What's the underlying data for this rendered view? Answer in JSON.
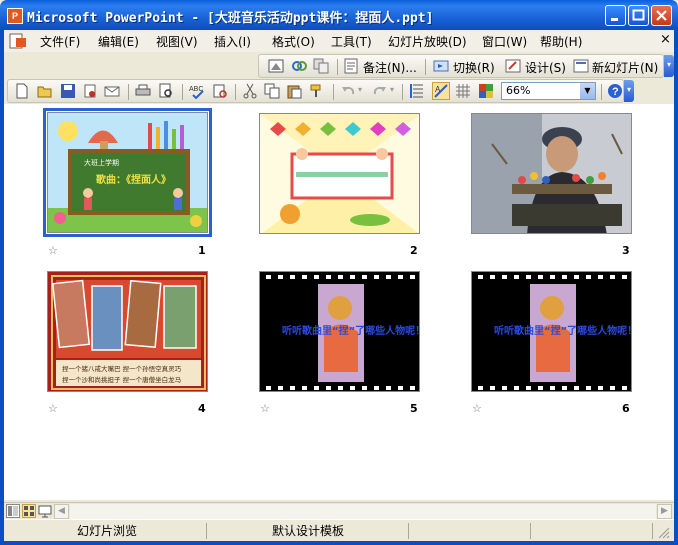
{
  "window": {
    "title": "Microsoft PowerPoint - [大班音乐活动ppt课件：捏面人.ppt]",
    "app_icon": "P"
  },
  "menubar": {
    "items": [
      "文件(F)",
      "编辑(E)",
      "视图(V)",
      "插入(I)",
      "格式(O)",
      "工具(T)",
      "幻灯片放映(D)",
      "窗口(W)",
      "帮助(H)"
    ],
    "close": "×"
  },
  "toolbar2": {
    "notes_label": "备注(N)...",
    "transition_label": "切换(R)",
    "design_label": "设计(S)",
    "new_slide_label": "新幻灯片(N)"
  },
  "toolbar1": {
    "zoom_value": "66%"
  },
  "slides": [
    {
      "number": "1",
      "title_line1": "大班上学期",
      "title_line2": "歌曲：《捏面人》"
    },
    {
      "number": "2"
    },
    {
      "number": "3"
    },
    {
      "number": "4",
      "caption_line1": "捏一个猪八戒大嘴巴  捏一个孙悟空真灵巧",
      "caption_line2": "捏一个沙和尚挑担子  捏一个唐僧坐白龙马"
    },
    {
      "number": "5",
      "text": "听听歌曲里“捏”了哪些人物呢！"
    },
    {
      "number": "6",
      "text": "听听歌曲里“捏”了哪些人物呢！"
    }
  ],
  "statusbar": {
    "view": "幻灯片浏览",
    "template": "默认设计模板"
  }
}
